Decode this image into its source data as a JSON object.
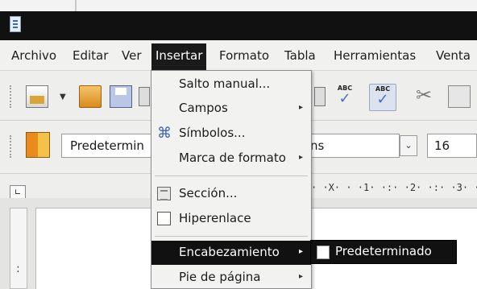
{
  "menubar": {
    "items": [
      "Archivo",
      "Editar",
      "Ver",
      "Insertar",
      "Formato",
      "Tabla",
      "Herramientas",
      "Venta"
    ],
    "active": "Insertar"
  },
  "toolbar2": {
    "paragraph_style": "Predetermin",
    "font_name": "ns",
    "font_size": "16"
  },
  "ruler": {
    "text": "· ·X· · ·1· ·:· ·2· ·:· ·3· ·"
  },
  "insert_menu": {
    "items": [
      {
        "label": "Salto manual...",
        "submenu": false
      },
      {
        "label": "Campos",
        "submenu": true
      },
      {
        "label": "Símbolos...",
        "submenu": false,
        "icon": "command-symbol-icon"
      },
      {
        "label": "Marca de formato",
        "submenu": true
      },
      {
        "label": "Sección...",
        "submenu": false,
        "icon": "section-icon"
      },
      {
        "label": "Hiperenlace",
        "submenu": false,
        "icon": "hyperlink-icon"
      },
      {
        "label": "Encabezamiento",
        "submenu": true,
        "highlighted": true
      },
      {
        "label": "Pie de página",
        "submenu": true
      }
    ]
  },
  "header_submenu": {
    "items": [
      {
        "label": "Predeterminado",
        "checked": false
      }
    ]
  },
  "colors": {
    "menu_highlight": "#111111",
    "title_bar": "#111111",
    "chrome": "#eeeeec"
  }
}
